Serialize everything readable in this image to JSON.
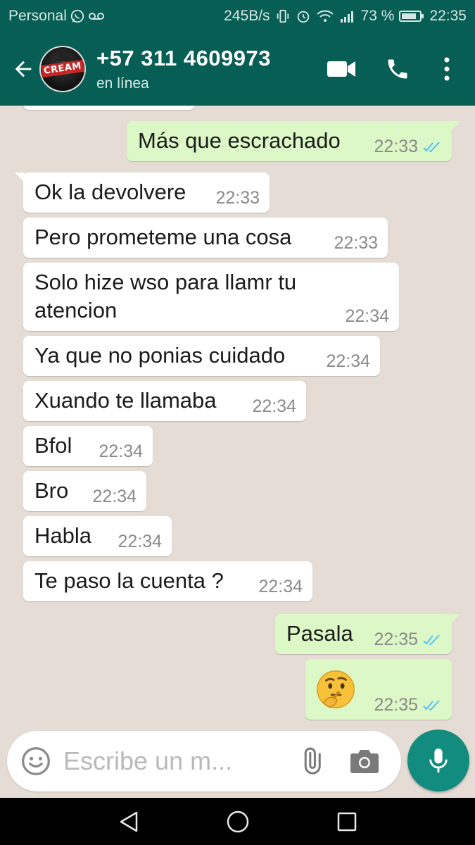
{
  "status_bar": {
    "carrier": "Personal",
    "net_speed": "245B/s",
    "battery": "73 %",
    "time": "22:35"
  },
  "header": {
    "contact_name": "+57 311 4609973",
    "status": "en línea",
    "avatar_label": "CREAM"
  },
  "messages": [
    {
      "dir": "out",
      "text": "Más que escrachado",
      "time": "22:33",
      "read": true
    },
    {
      "dir": "in",
      "text": "Ok la devolvere",
      "time": "22:33"
    },
    {
      "dir": "in",
      "text": "Pero prometeme una cosa",
      "time": "22:33"
    },
    {
      "dir": "in",
      "text_lines": [
        "Solo hize wso para llamr tu",
        "atencion"
      ],
      "time": "22:34"
    },
    {
      "dir": "in",
      "text": "Ya que no ponias cuidado",
      "time": "22:34"
    },
    {
      "dir": "in",
      "text": "Xuando te llamaba",
      "time": "22:34"
    },
    {
      "dir": "in",
      "text": "Bfol",
      "time": "22:34"
    },
    {
      "dir": "in",
      "text": "Bro",
      "time": "22:34"
    },
    {
      "dir": "in",
      "text": "Habla",
      "time": "22:34"
    },
    {
      "dir": "in",
      "text": "Te paso la cuenta ?",
      "time": "22:34"
    },
    {
      "dir": "out",
      "text": "Pasala",
      "time": "22:35",
      "read": true
    },
    {
      "dir": "out",
      "emoji": "thinking-face",
      "time": "22:35",
      "read": true
    }
  ],
  "composer": {
    "placeholder": "Escribe un m..."
  },
  "icons": {
    "back": "arrow-left-icon",
    "video": "video-camera-icon",
    "call": "phone-icon",
    "menu": "more-vert-icon",
    "emoji": "smiley-icon",
    "attach": "paperclip-icon",
    "camera": "camera-icon",
    "mic": "mic-icon",
    "nav_back": "triangle-back-icon",
    "nav_home": "circle-home-icon",
    "nav_recent": "square-recent-icon"
  },
  "colors": {
    "header": "#075e54",
    "outgoing_bubble": "#dcf8c6",
    "incoming_bubble": "#ffffff",
    "chat_bg": "#e5ddd5",
    "read_ticks": "#4fc3f7",
    "mic_button": "#128c7e"
  }
}
